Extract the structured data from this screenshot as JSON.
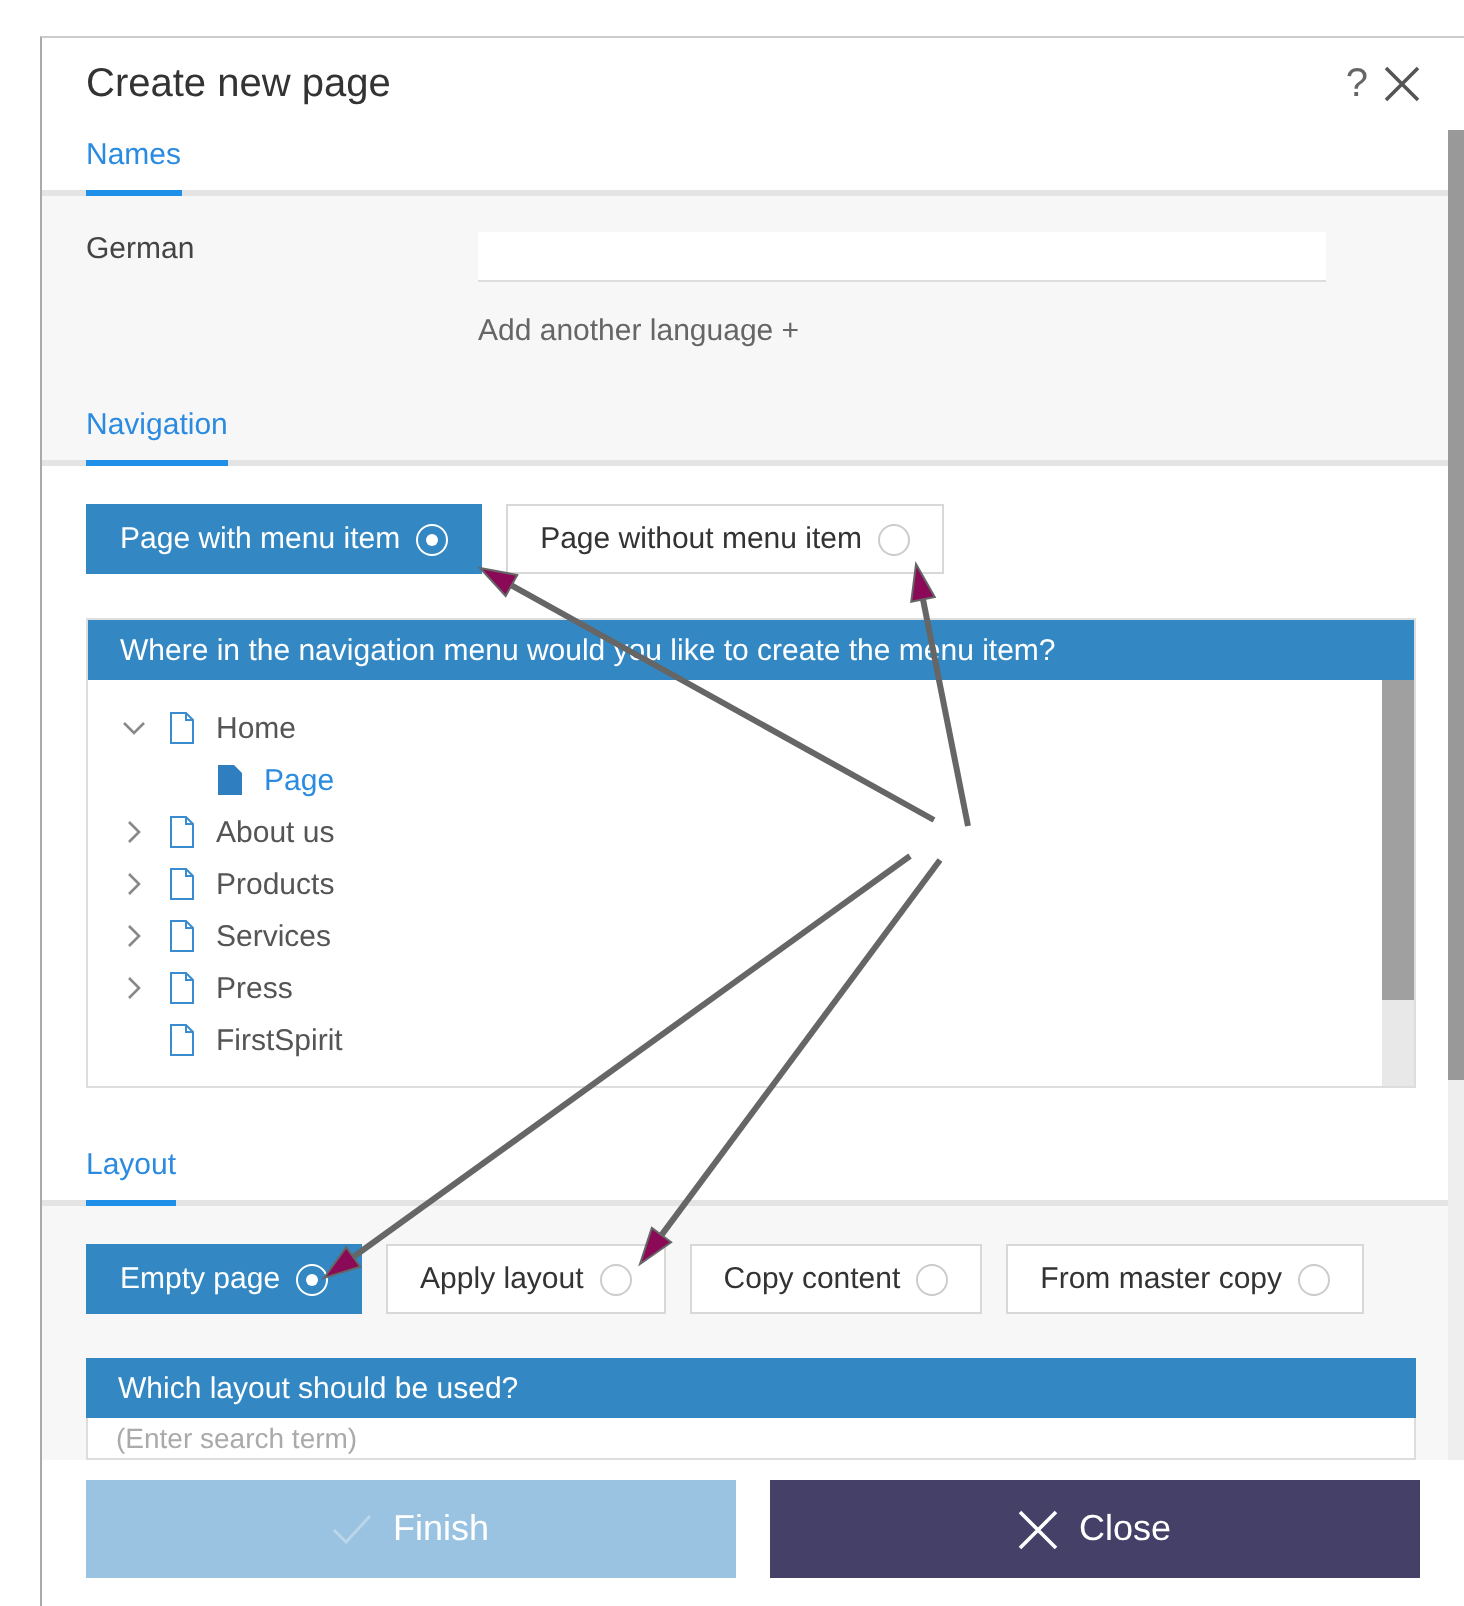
{
  "dialog": {
    "title": "Create new page",
    "help": "?"
  },
  "names": {
    "tab": "Names",
    "language_label": "German",
    "add_link": "Add another language +"
  },
  "navigation": {
    "tab": "Navigation",
    "options": [
      {
        "label": "Page with menu item",
        "selected": true
      },
      {
        "label": "Page without menu item",
        "selected": false
      }
    ],
    "tree_header": "Where in the navigation menu would you like to create the menu item?",
    "tree": [
      {
        "label": "Home",
        "expanded": true,
        "selected": false,
        "children": [
          {
            "label": "Page",
            "selected": true
          }
        ]
      },
      {
        "label": "About us",
        "expanded": false,
        "selected": false
      },
      {
        "label": "Products",
        "expanded": false,
        "selected": false
      },
      {
        "label": "Services",
        "expanded": false,
        "selected": false
      },
      {
        "label": "Press",
        "expanded": false,
        "selected": false
      },
      {
        "label": "FirstSpirit",
        "selected": false
      }
    ]
  },
  "layout": {
    "tab": "Layout",
    "options": [
      {
        "label": "Empty page",
        "selected": true
      },
      {
        "label": "Apply layout",
        "selected": false
      },
      {
        "label": "Copy content",
        "selected": false
      },
      {
        "label": "From master copy",
        "selected": false
      }
    ],
    "list_header": "Which layout should be used?",
    "search_placeholder": "(Enter search term)"
  },
  "buttons": [
    {
      "kind": "finish",
      "label": "Finish",
      "disabled": true
    },
    {
      "kind": "close",
      "label": "Close",
      "disabled": false
    }
  ]
}
